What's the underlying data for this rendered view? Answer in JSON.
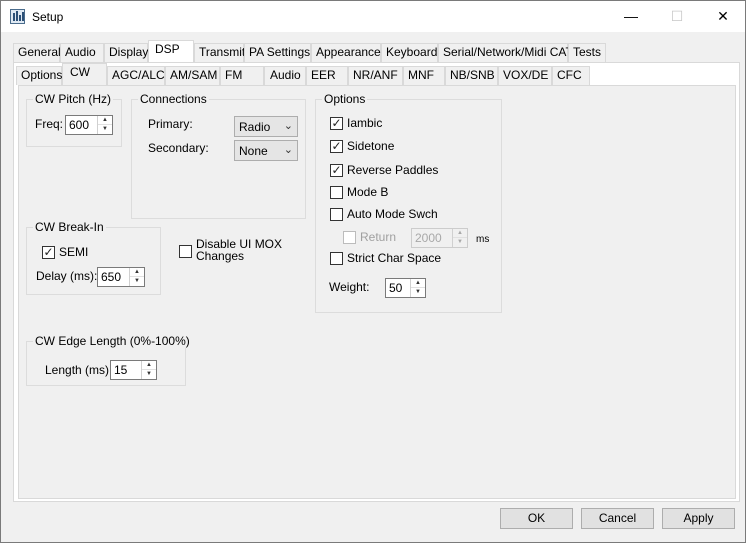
{
  "window": {
    "title": "Setup",
    "minimize": "—",
    "maximize": "☐",
    "close": "✕"
  },
  "tabs_main": [
    "General",
    "Audio",
    "Display",
    "DSP",
    "Transmit",
    "PA Settings",
    "Appearance",
    "Keyboard",
    "Serial/Network/Midi CAT",
    "Tests"
  ],
  "tabs_main_selected": "DSP",
  "tabs_sub": [
    "Options",
    "CW",
    "AGC/ALC",
    "AM/SAM",
    "FM",
    "Audio",
    "EER",
    "NR/ANF",
    "MNF",
    "NB/SNB",
    "VOX/DE",
    "CFC"
  ],
  "tabs_sub_selected": "CW",
  "cw_pitch": {
    "title": "CW Pitch (Hz)",
    "freq_label": "Freq:",
    "freq_value": "600"
  },
  "connections": {
    "title": "Connections",
    "primary_label": "Primary:",
    "primary_value": "Radio",
    "secondary_label": "Secondary:",
    "secondary_value": "None"
  },
  "options": {
    "title": "Options",
    "iambic": {
      "label": "Iambic",
      "checked": true
    },
    "sidetone": {
      "label": "Sidetone",
      "checked": true
    },
    "reverse_paddles": {
      "label": "Reverse Paddles",
      "checked": true
    },
    "mode_b": {
      "label": "Mode B",
      "checked": false
    },
    "auto_mode_swch": {
      "label": "Auto Mode Swch",
      "checked": false
    },
    "return": {
      "label": "Return",
      "checked": false,
      "value": "2000",
      "unit": "ms"
    },
    "strict_char_space": {
      "label": "Strict Char Space",
      "checked": false
    },
    "weight_label": "Weight:",
    "weight_value": "50"
  },
  "cw_break_in": {
    "title": "CW Break-In",
    "semi": {
      "label": "SEMI",
      "checked": true
    },
    "delay_label": "Delay (ms):",
    "delay_value": "650"
  },
  "disable_ui_mox": {
    "label_line1": "Disable UI MOX",
    "label_line2": "Changes",
    "checked": false
  },
  "cw_edge": {
    "title": "CW Edge Length (0%-100%)",
    "length_label": "Length (ms):",
    "length_value": "15"
  },
  "buttons": {
    "ok": "OK",
    "cancel": "Cancel",
    "apply": "Apply"
  },
  "icons": {
    "spin_up": "▲",
    "spin_down": "▼",
    "combo_arrow": "⌄",
    "check": "✓"
  }
}
